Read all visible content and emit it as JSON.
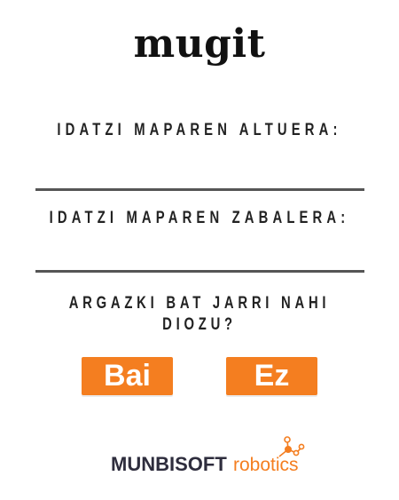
{
  "app": {
    "title": "mugit"
  },
  "form": {
    "height_label": "IDATZI MAPAREN ALTUERA:",
    "height_value": "",
    "width_label": "IDATZI MAPAREN ZABALERA:",
    "width_value": "",
    "photo_question": "ARGAZKI BAT JARRI NAHI DIOZU?"
  },
  "buttons": {
    "yes_label": "Bai",
    "no_label": "Ez"
  },
  "logo": {
    "brand_left": "MUNBISOFT",
    "brand_right": "robotics"
  },
  "colors": {
    "accent": "#f47e20",
    "logo_dark": "#2e2d3d",
    "underline": "#555555"
  }
}
